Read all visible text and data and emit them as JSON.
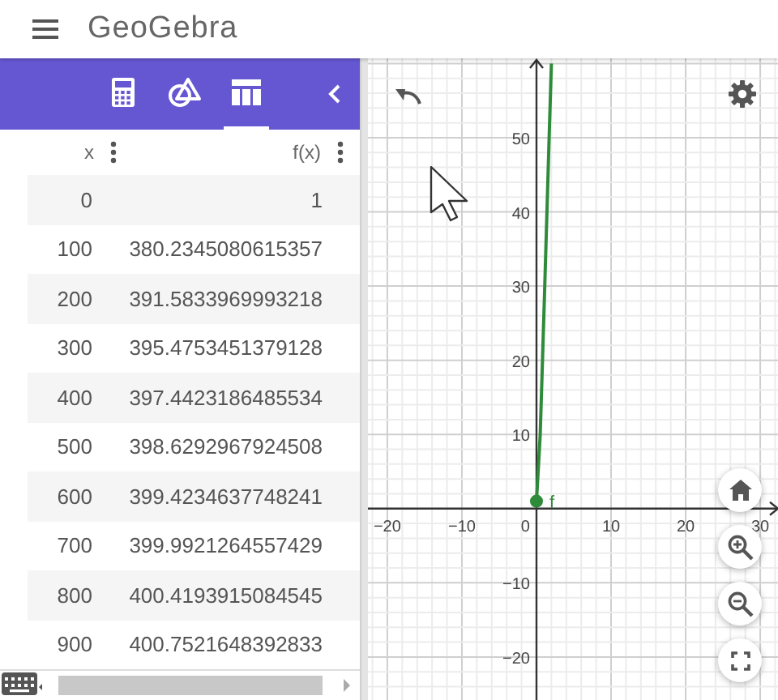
{
  "app": {
    "title": "GeoGebra"
  },
  "tabs": [
    {
      "kind": "calculator",
      "selected": false
    },
    {
      "kind": "geometry",
      "selected": false
    },
    {
      "kind": "table",
      "selected": true
    }
  ],
  "table": {
    "columns": [
      "x",
      "f(x)"
    ],
    "rows": [
      [
        "0",
        "1"
      ],
      [
        "100",
        "380.2345080615357"
      ],
      [
        "200",
        "391.5833969993218"
      ],
      [
        "300",
        "395.4753451379128"
      ],
      [
        "400",
        "397.4423186485534"
      ],
      [
        "500",
        "398.6292967924508"
      ],
      [
        "600",
        "399.4234637748241"
      ],
      [
        "700",
        "399.9921264557429"
      ],
      [
        "800",
        "400.4193915084545"
      ],
      [
        "900",
        "400.7521648392833"
      ]
    ]
  },
  "graph": {
    "origin_label": "0",
    "chart_data": {
      "type": "line",
      "grid": true,
      "xlim": [
        -22.6,
        32.6
      ],
      "ylim": [
        -25.8,
        60.7
      ],
      "xticks": [
        {
          "value": -20,
          "label": "−20"
        },
        {
          "value": -10,
          "label": "−10"
        },
        10,
        20,
        30
      ],
      "yticks": [
        {
          "value": -20,
          "label": "−20"
        },
        {
          "value": -10,
          "label": "−10"
        },
        10,
        20,
        30,
        40,
        50
      ],
      "x": [
        0,
        0.5,
        0.8,
        1.1,
        1.7,
        2
      ],
      "series": [
        {
          "name": "f",
          "color": "#2e8b3a",
          "values": [
            1,
            10,
            20,
            30,
            50,
            60
          ]
        }
      ]
    }
  }
}
